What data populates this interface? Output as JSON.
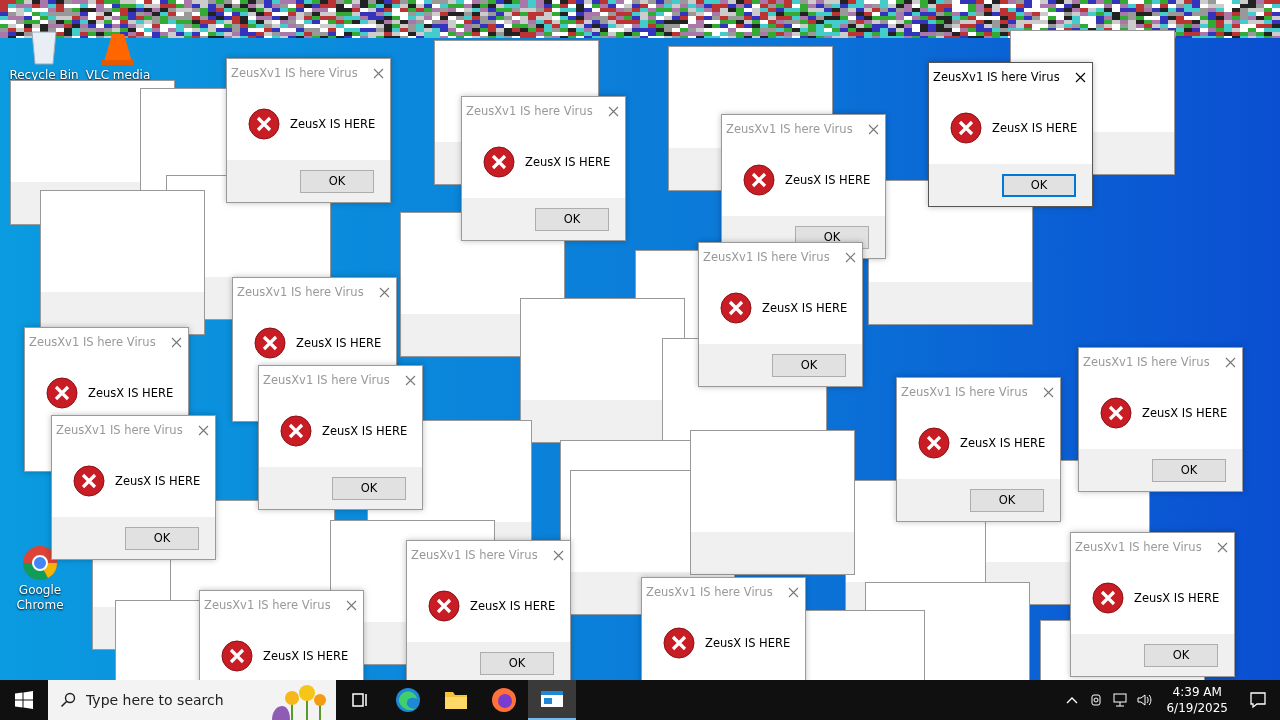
{
  "desktop_icons": [
    {
      "kind": "recycle",
      "label": "Recycle Bin"
    },
    {
      "kind": "vlc",
      "label": "VLC media"
    },
    {
      "kind": "chrome",
      "label": "Google Chrome"
    }
  ],
  "dialogs": [
    {
      "title": "ZeusXv1 IS here Virus",
      "message": "ZeusX IS HERE",
      "button": "OK",
      "active": false
    },
    {
      "title": "ZeusXv1 IS here Virus",
      "message": "ZeusX IS HERE",
      "button": "OK",
      "active": true
    },
    {
      "title": "ZeusXv1 IS here Virus",
      "message": "ZeusX IS HERE",
      "button": "OK",
      "active": false
    },
    {
      "title": "ZeusXv1 IS here Virus",
      "message": "ZeusX IS HERE",
      "button": "OK",
      "active": false
    },
    {
      "title": "ZeusXv1 IS here Virus",
      "message": "ZeusX IS HERE",
      "button": "OK",
      "active": false
    },
    {
      "title": "ZeusXv1 IS here Virus",
      "message": "ZeusX IS HERE",
      "active": false
    },
    {
      "title": "ZeusXv1 IS here Virus",
      "message": "ZeusX IS HERE",
      "active": false
    },
    {
      "title": "ZeusXv1 IS here Virus",
      "message": "ZeusX IS HERE",
      "button": "OK",
      "active": false
    },
    {
      "title": "ZeusXv1 IS here Virus",
      "message": "ZeusX IS HERE",
      "button": "OK",
      "active": false
    },
    {
      "title": "ZeusXv1 IS here Virus",
      "message": "ZeusX IS HERE",
      "button": "OK",
      "active": false
    },
    {
      "title": "ZeusXv1 IS here Virus",
      "message": "ZeusX IS HERE",
      "button": "OK",
      "active": false
    },
    {
      "title": "ZeusXv1 IS here Virus",
      "message": "ZeusX IS HERE",
      "button": "OK",
      "active": false
    },
    {
      "title": "ZeusXv1 IS here Virus",
      "message": "ZeusX IS HERE",
      "button": "OK",
      "active": false
    },
    {
      "title": "ZeusXv1 IS here Virus",
      "message": "ZeusX IS HERE",
      "active": false
    },
    {
      "title": "ZeusXv1 IS here Virus",
      "message": "ZeusX IS HERE",
      "active": false
    }
  ],
  "taskbar": {
    "search": {
      "placeholder": "Type here to search"
    },
    "apps": [
      {
        "kind": "taskview",
        "selected": false
      },
      {
        "kind": "edge",
        "selected": false
      },
      {
        "kind": "folder",
        "selected": false
      },
      {
        "kind": "firefox",
        "selected": false
      },
      {
        "kind": "window",
        "selected": true
      }
    ],
    "time": "4:39 AM",
    "date": "6/19/2025"
  }
}
